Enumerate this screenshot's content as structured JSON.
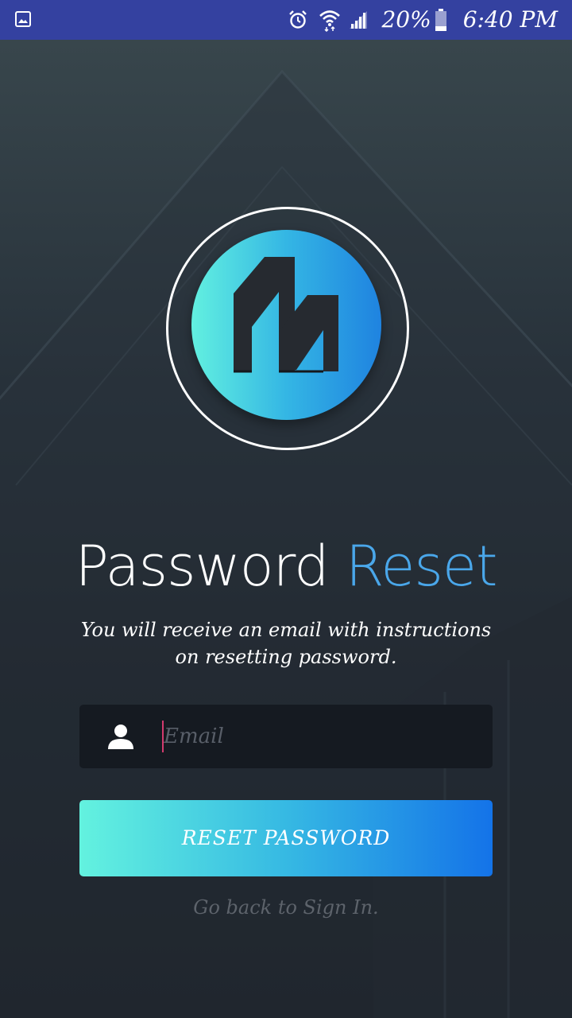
{
  "status_bar": {
    "left_icon": "gallery-icon",
    "alarm_icon": "alarm-icon",
    "wifi_icon": "wifi-icon",
    "signal_icon": "signal-icon",
    "battery_percent": "20%",
    "battery_icon": "battery-icon",
    "time": "6:40 PM",
    "background_color": "#3441a0"
  },
  "logo": {
    "icon": "building-logo-icon",
    "gradient_start": "#62f0e0",
    "gradient_end": "#1f83e0"
  },
  "title": {
    "part1": "Password",
    "part2": "Reset",
    "part2_color": "#4aa7ea"
  },
  "subtitle": {
    "line1": "You will receive an email with instructions",
    "line2": "on resetting password."
  },
  "email": {
    "icon": "user-icon",
    "value": "",
    "placeholder": "Email"
  },
  "reset_button": {
    "label": "RESET PASSWORD",
    "gradient_start": "#63f2df",
    "gradient_end": "#1473e8"
  },
  "back_link": {
    "label": "Go back to Sign In."
  }
}
